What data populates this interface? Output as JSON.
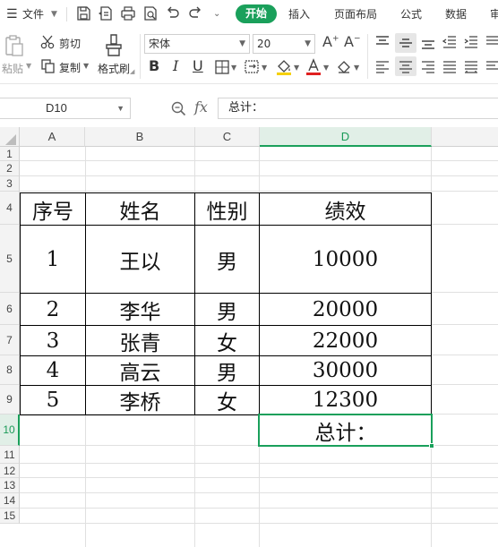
{
  "menubar": {
    "file_label": "文件",
    "tabs": [
      "开始",
      "插入",
      "页面布局",
      "公式",
      "数据",
      "审"
    ]
  },
  "ribbon": {
    "paste_label": "粘贴",
    "cut_label": "剪切",
    "copy_label": "复制",
    "format_painter_label": "格式刷",
    "font_name": "宋体",
    "font_size": "20"
  },
  "formula_bar": {
    "cell_ref": "D10",
    "content": "总计："
  },
  "sheet": {
    "columns": [
      "A",
      "B",
      "C",
      "D"
    ],
    "rows": [
      "1",
      "2",
      "3",
      "4",
      "5",
      "6",
      "7",
      "8",
      "9",
      "10",
      "11",
      "12",
      "13",
      "14",
      "15"
    ],
    "selected_cell": "D10",
    "header": [
      "序号",
      "姓名",
      "性别",
      "绩效"
    ],
    "data": [
      [
        "1",
        "王以",
        "男",
        "10000"
      ],
      [
        "2",
        "李华",
        "男",
        "20000"
      ],
      [
        "3",
        "张青",
        "女",
        "22000"
      ],
      [
        "4",
        "高云",
        "男",
        "30000"
      ],
      [
        "5",
        "李桥",
        "女",
        "12300"
      ]
    ],
    "total_label": "总计："
  },
  "colors": {
    "accent": "#1aa05b",
    "font_color_bar": "#e02020",
    "highlight_bar": "#f5d000"
  }
}
